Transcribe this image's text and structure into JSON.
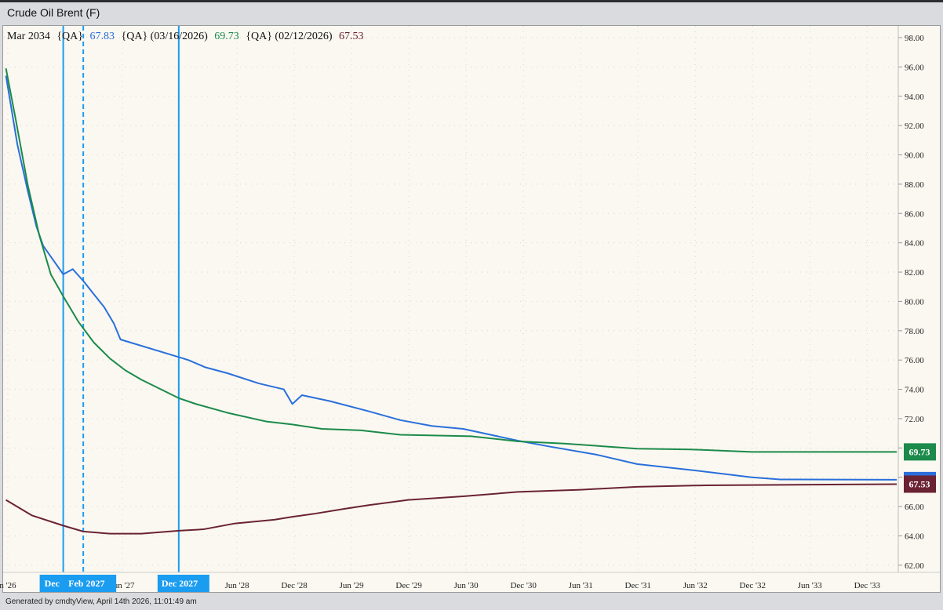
{
  "title": "Crude Oil Brent (F)",
  "footer": "Generated by cmdtyView, April 14th 2026, 11:01:49 am",
  "legend": {
    "contract": "Mar 2034",
    "s1_tag": "{QA}",
    "s1_value": "67.83",
    "s2_tag": "{QA} (03/16/2026)",
    "s2_value": "69.73",
    "s3_tag": "{QA} (02/12/2026)",
    "s3_value": "67.53"
  },
  "chart_data": {
    "type": "line",
    "title": "Crude Oil Brent (F)",
    "x_unit": "months since Jun 2026",
    "ylim": [
      61,
      99
    ],
    "xlim": [
      -0.4,
      93.5
    ],
    "yticks": [
      "62.00",
      "64.00",
      "66.00",
      "68.00",
      "70.00",
      "72.00",
      "74.00",
      "76.00",
      "78.00",
      "80.00",
      "82.00",
      "84.00",
      "86.00",
      "88.00",
      "90.00",
      "92.00",
      "94.00",
      "96.00",
      "98.00"
    ],
    "xticks": [
      {
        "m": 0,
        "label": "n '26"
      },
      {
        "m": 12,
        "label": "Jun '27"
      },
      {
        "m": 24,
        "label": "Jun '28"
      },
      {
        "m": 30,
        "label": "Dec '28"
      },
      {
        "m": 36,
        "label": "Jun '29"
      },
      {
        "m": 42,
        "label": "Dec '29"
      },
      {
        "m": 48,
        "label": "Jun '30"
      },
      {
        "m": 54,
        "label": "Dec '30"
      },
      {
        "m": 60,
        "label": "Jun '31"
      },
      {
        "m": 66,
        "label": "Dec '31"
      },
      {
        "m": 72,
        "label": "Jun '32"
      },
      {
        "m": 78,
        "label": "Dec '32"
      },
      {
        "m": 84,
        "label": "Jun '33"
      },
      {
        "m": 90,
        "label": "Dec '33"
      }
    ],
    "markers": [
      {
        "m": 5.8,
        "label": "Dec",
        "style": "solid"
      },
      {
        "m": 7.9,
        "label": "Feb 2027",
        "style": "dashed"
      },
      {
        "m": 17.9,
        "label": "Dec 2027",
        "style": "solid"
      }
    ],
    "series": [
      {
        "name": "{QA}",
        "color": "#2a6fdb",
        "last": "67.83",
        "points": [
          [
            -0.2,
            95.4
          ],
          [
            1.0,
            90.7
          ],
          [
            2.1,
            87.5
          ],
          [
            3.0,
            85.1
          ],
          [
            3.7,
            83.8
          ],
          [
            5.8,
            81.85
          ],
          [
            6.8,
            82.2
          ],
          [
            7.9,
            81.4
          ],
          [
            9.0,
            80.5
          ],
          [
            10.1,
            79.6
          ],
          [
            11.1,
            78.5
          ],
          [
            11.8,
            77.4
          ],
          [
            17.9,
            76.2
          ],
          [
            18.9,
            76.0
          ],
          [
            20.7,
            75.5
          ],
          [
            23.0,
            75.1
          ],
          [
            26.3,
            74.4
          ],
          [
            28.9,
            74.0
          ],
          [
            29.8,
            73.0
          ],
          [
            30.8,
            73.6
          ],
          [
            33.7,
            73.2
          ],
          [
            37.8,
            72.5
          ],
          [
            41.1,
            71.9
          ],
          [
            44.4,
            71.5
          ],
          [
            47.7,
            71.3
          ],
          [
            53.4,
            70.5
          ],
          [
            56.7,
            70.1
          ],
          [
            61.6,
            69.55
          ],
          [
            65.9,
            68.9
          ],
          [
            71.5,
            68.5
          ],
          [
            77.9,
            68.0
          ],
          [
            80.9,
            67.85
          ],
          [
            93.1,
            67.83
          ]
        ]
      },
      {
        "name": "{QA} (03/16/2026)",
        "color": "#1c8a4a",
        "last": "69.73",
        "points": [
          [
            -0.2,
            95.9
          ],
          [
            0.8,
            92.5
          ],
          [
            2.1,
            87.9
          ],
          [
            3.3,
            84.5
          ],
          [
            4.5,
            81.85
          ],
          [
            5.8,
            80.35
          ],
          [
            7.4,
            78.6
          ],
          [
            9.0,
            77.2
          ],
          [
            10.7,
            76.1
          ],
          [
            12.3,
            75.3
          ],
          [
            14.0,
            74.65
          ],
          [
            17.9,
            73.4
          ],
          [
            19.7,
            73.0
          ],
          [
            23.0,
            72.4
          ],
          [
            27.1,
            71.8
          ],
          [
            29.8,
            71.6
          ],
          [
            32.9,
            71.3
          ],
          [
            37.0,
            71.2
          ],
          [
            41.1,
            70.9
          ],
          [
            48.5,
            70.8
          ],
          [
            53.4,
            70.45
          ],
          [
            58.3,
            70.3
          ],
          [
            65.9,
            69.95
          ],
          [
            71.5,
            69.9
          ],
          [
            77.9,
            69.73
          ],
          [
            93.1,
            69.73
          ]
        ]
      },
      {
        "name": "{QA} (02/12/2026)",
        "color": "#6b2233",
        "last": "67.53",
        "points": [
          [
            -0.2,
            66.45
          ],
          [
            2.5,
            65.4
          ],
          [
            5.8,
            64.7
          ],
          [
            7.9,
            64.3
          ],
          [
            10.7,
            64.15
          ],
          [
            14.0,
            64.15
          ],
          [
            17.9,
            64.35
          ],
          [
            20.5,
            64.45
          ],
          [
            23.8,
            64.85
          ],
          [
            27.9,
            65.1
          ],
          [
            29.8,
            65.3
          ],
          [
            32.0,
            65.5
          ],
          [
            35.3,
            65.85
          ],
          [
            37.8,
            66.1
          ],
          [
            41.9,
            66.45
          ],
          [
            47.7,
            66.7
          ],
          [
            53.4,
            67.0
          ],
          [
            60.0,
            67.15
          ],
          [
            65.9,
            67.35
          ],
          [
            73.1,
            67.45
          ],
          [
            93.1,
            67.53
          ]
        ]
      }
    ]
  }
}
